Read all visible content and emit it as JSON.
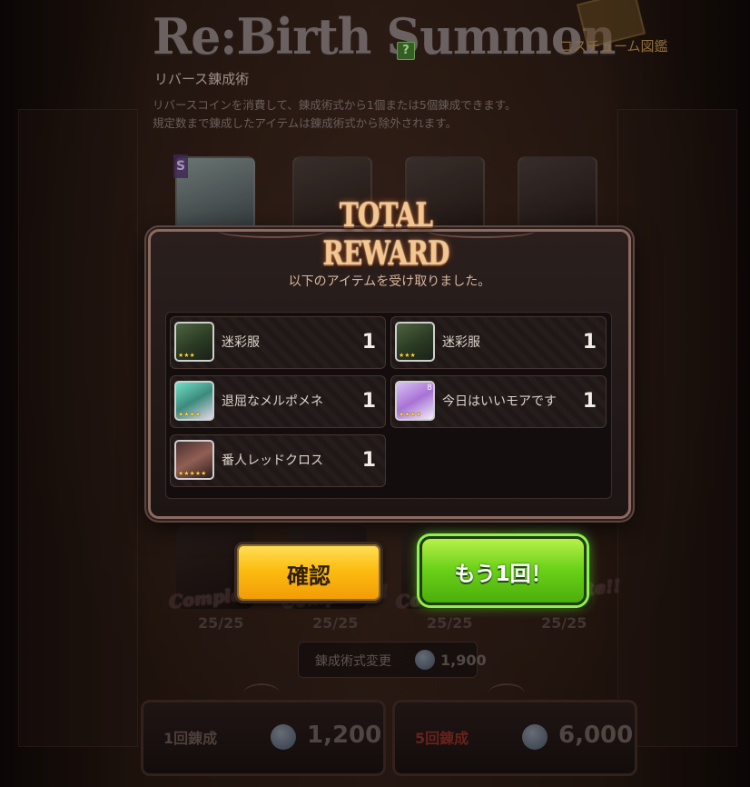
{
  "header": {
    "logo_text": "Re:Birth Summon",
    "help_label": "?",
    "subtitle": "リバース錬成術",
    "description_line1": "リバースコインを消費して、錬成術式から1個または5個錬成できます。",
    "description_line2": "規定数まで錬成したアイテムは錬成術式から除外されます。",
    "costume_link": "コスチューム図鑑"
  },
  "background_slots": {
    "top_badge": "S",
    "complete_label": "Complete!!",
    "counts": [
      "25/25",
      "25/25",
      "25/25",
      "25/25"
    ]
  },
  "formula_change": {
    "label": "錬成術式変更",
    "cost": "1,900"
  },
  "summon_buttons": [
    {
      "label": "1回錬成",
      "cost": "1,200"
    },
    {
      "label": "5回錬成",
      "cost": "6,000"
    }
  ],
  "modal": {
    "title": "TOTAL REWARD",
    "message": "以下のアイテムを受け取りました。",
    "items": [
      {
        "name": "迷彩服",
        "qty": "1",
        "stars": "★★★",
        "icon": "camo-outfit-icon"
      },
      {
        "name": "迷彩服",
        "qty": "1",
        "stars": "★★★",
        "icon": "camo-outfit-icon"
      },
      {
        "name": "退屈なメルポメネ",
        "qty": "1",
        "stars": "★★★★",
        "icon": "character-melpomene-icon"
      },
      {
        "name": "今日はいいモアです",
        "qty": "1",
        "stars": "★★★★",
        "icon": "character-moa-icon",
        "badge": "8"
      },
      {
        "name": "番人レッドクロス",
        "qty": "1",
        "stars": "★★★★★",
        "icon": "character-redcross-icon"
      }
    ],
    "confirm_label": "確認",
    "again_label": "もう1回！"
  },
  "colors": {
    "confirm_button": "#fbbd11",
    "again_button": "#6ad118",
    "title_glow": "#f3c78f",
    "five_summon_label": "#8a2a22"
  }
}
